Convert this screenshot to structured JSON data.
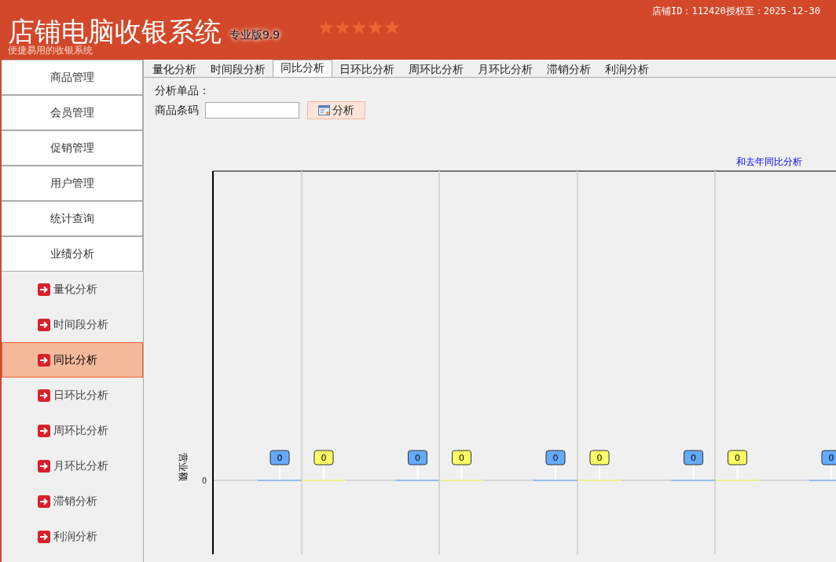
{
  "header": {
    "title": "店铺电脑收银系统",
    "edition": "专业版9.9",
    "subtitle": "便捷易用的收银系统",
    "license": "店铺ID：112420授权至：2025-12-30"
  },
  "sidebar": {
    "items": [
      {
        "kind": "section",
        "label": "商品管理",
        "selected": false
      },
      {
        "kind": "section",
        "label": "会员管理",
        "selected": false
      },
      {
        "kind": "section",
        "label": "促销管理",
        "selected": false
      },
      {
        "kind": "section",
        "label": "用户管理",
        "selected": false
      },
      {
        "kind": "section",
        "label": "统计查询",
        "selected": false
      },
      {
        "kind": "section",
        "label": "业绩分析",
        "selected": false
      },
      {
        "kind": "sub",
        "label": "量化分析",
        "selected": false
      },
      {
        "kind": "sub",
        "label": "时间段分析",
        "selected": false
      },
      {
        "kind": "sub",
        "label": "同比分析",
        "selected": true
      },
      {
        "kind": "sub",
        "label": "日环比分析",
        "selected": false
      },
      {
        "kind": "sub",
        "label": "周环比分析",
        "selected": false
      },
      {
        "kind": "sub",
        "label": "月环比分析",
        "selected": false
      },
      {
        "kind": "sub",
        "label": "滞销分析",
        "selected": false
      },
      {
        "kind": "sub",
        "label": "利润分析",
        "selected": false
      }
    ]
  },
  "tabs": [
    {
      "label": "量化分析",
      "selected": false
    },
    {
      "label": "时间段分析",
      "selected": false
    },
    {
      "label": "同比分析",
      "selected": true
    },
    {
      "label": "日环比分析",
      "selected": false
    },
    {
      "label": "周环比分析",
      "selected": false
    },
    {
      "label": "月环比分析",
      "selected": false
    },
    {
      "label": "滞销分析",
      "selected": false
    },
    {
      "label": "利润分析",
      "selected": false
    }
  ],
  "form": {
    "section_label": "分析单品：",
    "barcode_label": "商品条码",
    "analyze_button": "分析"
  },
  "chart": {
    "title": "和去年同比分析",
    "ylabel": "营业额",
    "zero_tick": "0",
    "groups": [
      {
        "markers": [
          {
            "label": "0",
            "color": "#66aaff"
          },
          {
            "label": "0",
            "color": "#ffff66"
          }
        ]
      },
      {
        "markers": [
          {
            "label": "0",
            "color": "#66aaff"
          },
          {
            "label": "0",
            "color": "#ffff66"
          }
        ]
      },
      {
        "markers": [
          {
            "label": "0",
            "color": "#66aaff"
          },
          {
            "label": "0",
            "color": "#ffff66"
          }
        ]
      },
      {
        "markers": [
          {
            "label": "0",
            "color": "#66aaff"
          },
          {
            "label": "0",
            "color": "#ffff66"
          }
        ]
      },
      {
        "markers": [
          {
            "label": "0",
            "color": "#66aaff"
          }
        ]
      }
    ]
  }
}
